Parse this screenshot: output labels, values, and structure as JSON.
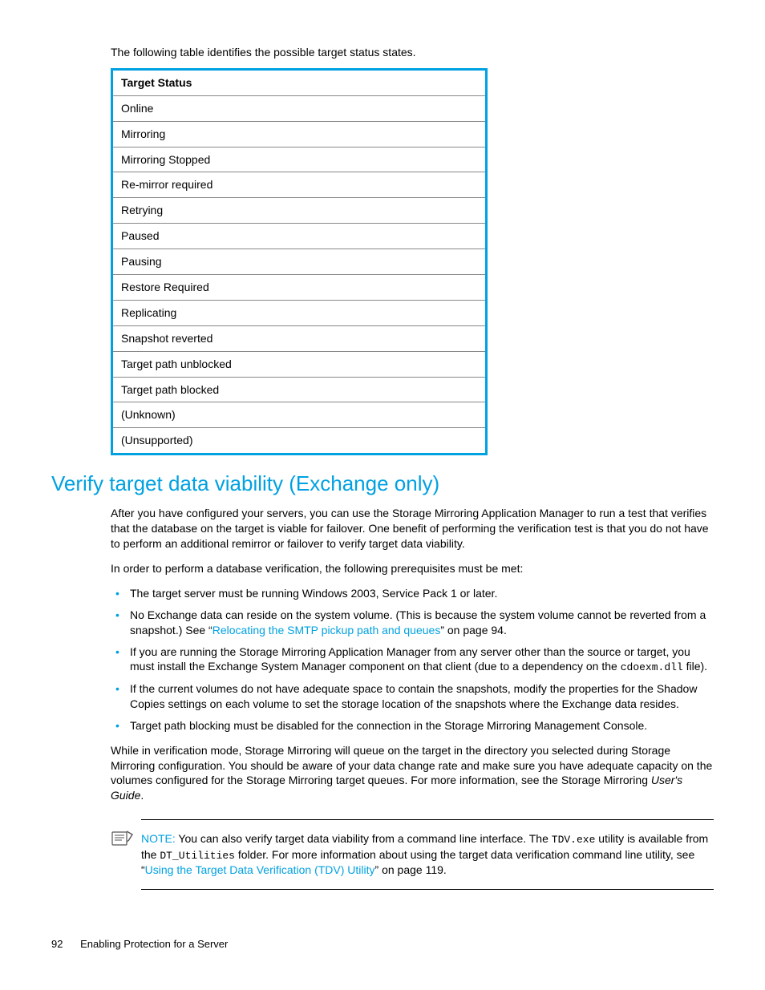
{
  "intro": "The following table identifies the possible target status states.",
  "table": {
    "header": "Target Status",
    "rows": [
      "Online",
      "Mirroring",
      "Mirroring Stopped",
      "Re-mirror required",
      "Retrying",
      "Paused",
      "Pausing",
      "Restore Required",
      "Replicating",
      "Snapshot reverted",
      "Target path unblocked",
      "Target path blocked",
      "(Unknown)",
      "(Unsupported)"
    ]
  },
  "heading": "Verify target data viability (Exchange only)",
  "para1": "After you have configured your servers, you can use the Storage Mirroring Application Manager to run a test that verifies that the database on the target is viable for failover. One benefit of performing the verification test is that you do not have to perform an additional remirror or failover to verify target data viability.",
  "para2": "In order to perform a database verification, the following prerequisites must be met:",
  "bullets": {
    "b1": "The target server must be running Windows 2003, Service Pack 1 or later.",
    "b2a": "No Exchange data can reside on the system volume. (This is because the system volume cannot be reverted from a snapshot.) See “",
    "b2link": "Relocating the SMTP pickup path and queues",
    "b2b": "” on page 94.",
    "b3a": "If you are running the Storage Mirroring Application Manager from any server other than the source or target, you must install the Exchange System Manager component on that client (due to a dependency on the ",
    "b3code": "cdoexm.dll",
    "b3b": " file).",
    "b4": "If the current volumes do not have adequate space to contain the snapshots, modify the properties for the Shadow Copies settings on each volume to set the storage location of the snapshots where the Exchange data resides.",
    "b5": "Target path blocking must be disabled for the connection in the Storage Mirroring Management Console."
  },
  "para3a": "While in verification mode, Storage Mirroring will queue on the target in the directory you selected during Storage Mirroring configuration. You should be aware of your data change rate and make sure you have adequate capacity on the volumes configured for the Storage Mirroring target queues. For more information, see the Storage Mirroring ",
  "para3italic": "User's Guide",
  "para3b": ".",
  "note": {
    "label": "NOTE:",
    "t1": "  You can also verify target data viability from a command line interface. The ",
    "code1": "TDV.exe",
    "t2": " utility is available from the ",
    "code2": "DT_Utilities",
    "t3": " folder. For more information about using the target data verification command line utility, see “",
    "link": "Using the Target Data Verification (TDV) Utility",
    "t4": "” on page 119."
  },
  "footer": {
    "page": "92",
    "title": "Enabling Protection for a Server"
  }
}
